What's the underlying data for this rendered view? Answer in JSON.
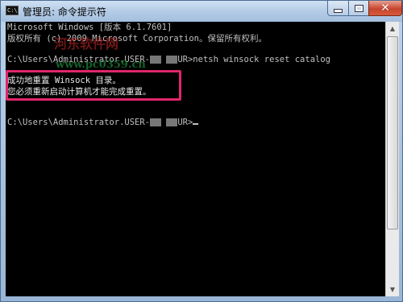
{
  "window": {
    "title": "管理员: 命令提示符",
    "icon": "cmd-icon",
    "buttons": {
      "minimize": "minimize-icon",
      "maximize": "maximize-icon",
      "close": "✕"
    }
  },
  "console": {
    "lines": {
      "version": "Microsoft Windows [版本 6.1.7601]",
      "copyright": "版权所有 (c) 2009 Microsoft Corporation。保留所有权利。",
      "prompt1_prefix": "C:\\Users\\Administrator.USER-",
      "prompt1_suffix": "UR>netsh winsock reset catalog",
      "result1": "成功地重置 Winsock 目录。",
      "result2": "您必须重新启动计算机才能完成重置。",
      "prompt2_prefix": "C:\\Users\\Administrator.USER-",
      "prompt2_suffix": "UR>"
    },
    "highlight_color": "#e0266b"
  },
  "watermark": {
    "text": "河东软件网",
    "url": "www.pc0359.cn"
  }
}
